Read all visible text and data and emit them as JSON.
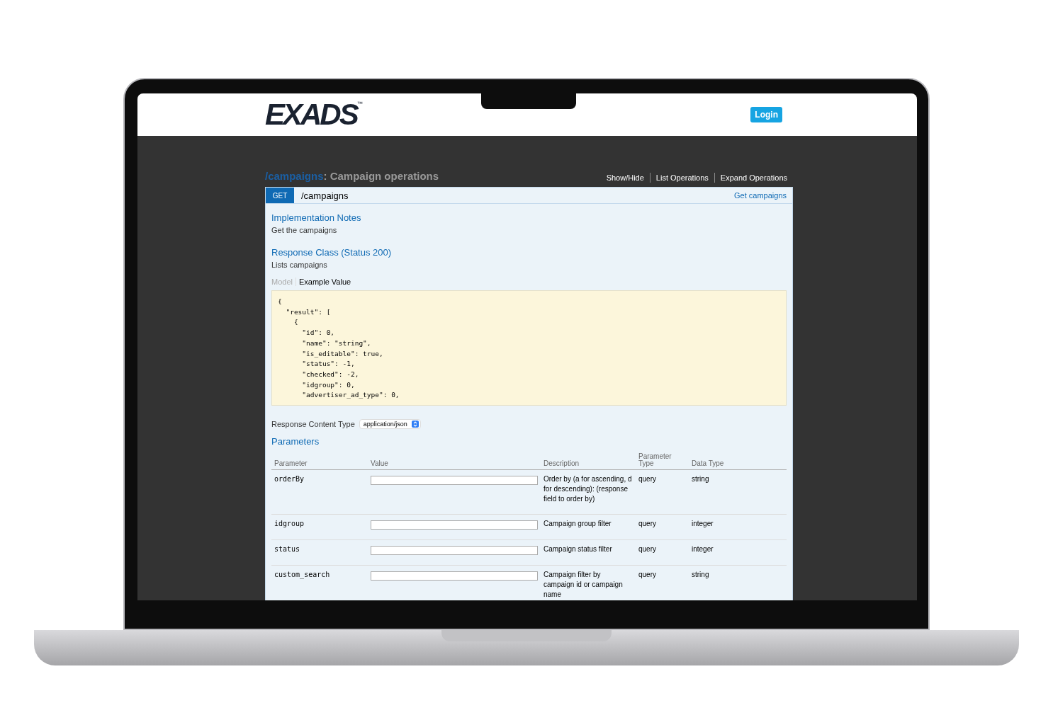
{
  "header": {
    "logo": "EXADS",
    "logo_mark": "™",
    "login": "Login"
  },
  "resource": {
    "path": "/campaigns",
    "separator": ":",
    "title": "Campaign operations",
    "links": [
      "Show/Hide",
      "List Operations",
      "Expand Operations"
    ]
  },
  "operation": {
    "method": "GET",
    "path": "/campaigns",
    "summary": "Get campaigns"
  },
  "implementation_notes": {
    "heading": "Implementation Notes",
    "text": "Get the campaigns"
  },
  "response_class": {
    "heading": "Response Class (Status 200)",
    "text": "Lists campaigns"
  },
  "model_tabs": [
    {
      "label": "Model",
      "selected": false
    },
    {
      "label": "Example Value",
      "selected": true
    }
  ],
  "example_lines": [
    "{",
    "  \"result\": [",
    "    {",
    "      \"id\": 0,",
    "      \"name\": \"string\",",
    "      \"is_editable\": true,",
    "      \"status\": -1,",
    "      \"checked\": -2,",
    "      \"idgroup\": 0,",
    "      \"advertiser_ad_type\": 0,"
  ],
  "response_content_type": {
    "label": "Response Content Type",
    "value": "application/json"
  },
  "parameters": {
    "heading": "Parameters",
    "columns": [
      "Parameter",
      "Value",
      "Description",
      "Parameter Type",
      "Data Type"
    ],
    "rows": [
      {
        "name": "orderBy",
        "description": "Order by (a for ascending, d for descending): (response field to order by)",
        "type": "query",
        "data_type": "string"
      },
      {
        "name": "idgroup",
        "description": "Campaign group filter",
        "type": "query",
        "data_type": "integer"
      },
      {
        "name": "status",
        "description": "Campaign status filter",
        "type": "query",
        "data_type": "integer"
      },
      {
        "name": "custom_search",
        "description": "Campaign filter by campaign id or campaign name",
        "type": "query",
        "data_type": "string"
      }
    ]
  }
}
